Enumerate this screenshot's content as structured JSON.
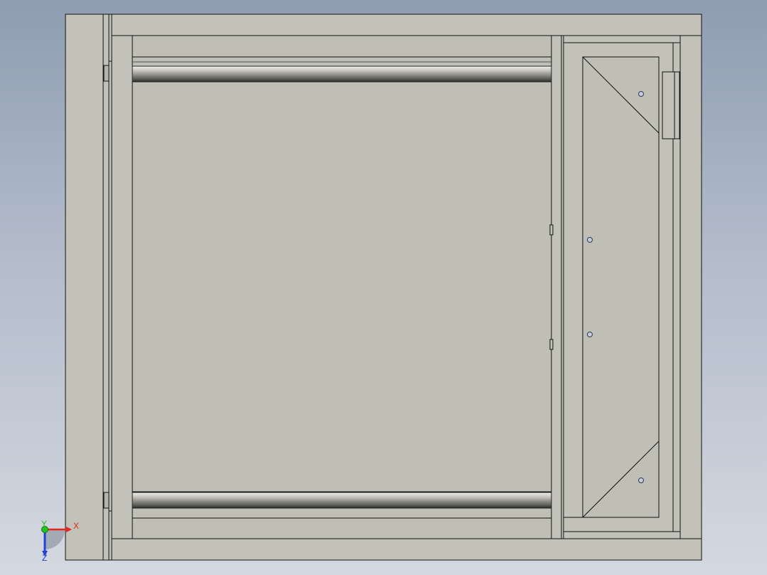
{
  "window": {
    "title": ""
  },
  "triad": {
    "x_label": "X",
    "y_label": "Y",
    "z_label": "Z",
    "x_color": "#e8261c",
    "y_color": "#1fc41f",
    "z_color": "#2340d8"
  },
  "colors": {
    "background_top": "#8e9db1",
    "background_bottom": "#d4d8e0",
    "part_fill": "#c2c2b8",
    "panel_fill": "#bfbfb5",
    "edge_line": "#111111",
    "hole_fill": "#c8ccd4",
    "hole_edge": "#2b3a66"
  }
}
